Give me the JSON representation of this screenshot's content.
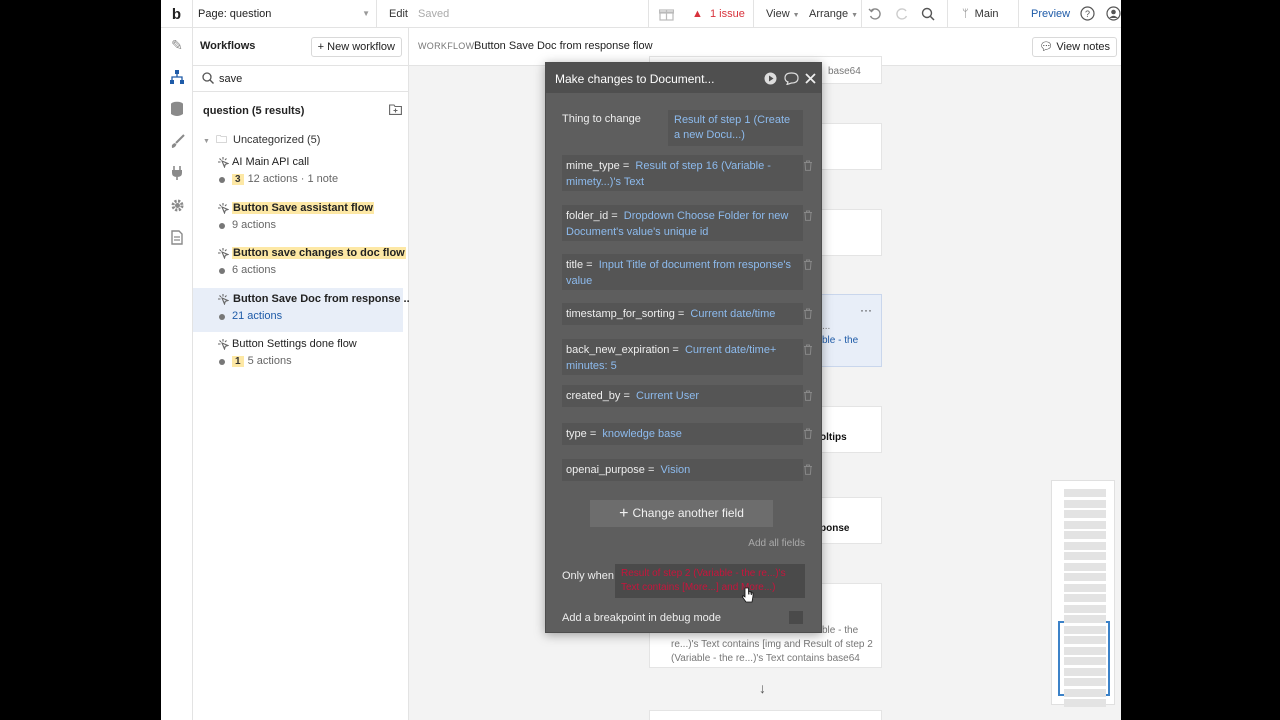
{
  "topbar": {
    "logo": "b",
    "page": "Page: question",
    "edit": "Edit",
    "saved": "Saved",
    "issues": "1 issue",
    "view": "View",
    "arrange": "Arrange",
    "branch": "Main",
    "preview": "Preview"
  },
  "workflows_panel": {
    "title": "Workflows",
    "new_workflow": "New workflow",
    "search_value": "save",
    "results": "question (5 results)",
    "folder": "Uncategorized (5)",
    "items": [
      {
        "name": "AI Main API call",
        "badge": "3",
        "meta": "12 actions · 1 note",
        "highlight": false,
        "selected": false
      },
      {
        "name": "Button Save assistant flow",
        "badge": "",
        "meta": "9 actions",
        "highlight": true,
        "selected": false
      },
      {
        "name": "Button save changes to doc flow",
        "badge": "",
        "meta": "6 actions",
        "highlight": true,
        "selected": false
      },
      {
        "name": "Button Save Doc from response ...",
        "badge": "",
        "meta": "21 actions",
        "highlight": true,
        "selected": true
      },
      {
        "name": "Button Settings done flow",
        "badge": "1",
        "meta": "5 actions",
        "highlight": false,
        "selected": false
      }
    ]
  },
  "canvas": {
    "workflow_label": "WORKFLOW:",
    "workflow_name": "Button Save Doc from response flow",
    "view_notes": "View notes",
    "card_texts": {
      "top": "base64",
      "mid_line1": "...",
      "mid_line2": "ble - the",
      "tooltips": "oltips",
      "response": "ponse",
      "bottom_line1": "ble - the",
      "bottom_line2": "re...)'s Text contains [img and Result of step 2",
      "bottom_line3": "(Variable - the re...)'s Text contains base64",
      "menu": "···"
    }
  },
  "popup": {
    "title": "Make changes to Document...",
    "thing_label": "Thing to change",
    "thing_value": "Result of step 1 (Create a new Docu...)",
    "fields": [
      {
        "key": "mime_type",
        "value": "Result of step 16 (Variable - mimety...)'s Text"
      },
      {
        "key": "folder_id",
        "value": "Dropdown Choose Folder for new Document's value's unique id"
      },
      {
        "key": "title",
        "value": "Input Title of document from response's value"
      },
      {
        "key": "timestamp_for_sorting",
        "value": "Current date/time"
      },
      {
        "key": "back_new_expiration",
        "value": "Current date/time+ minutes: 5"
      },
      {
        "key": "created_by",
        "value": "Current User"
      },
      {
        "key": "type",
        "value": "knowledge base"
      },
      {
        "key": "openai_purpose",
        "value": "Vision"
      }
    ],
    "change_another": "Change another field",
    "add_all": "Add all fields",
    "only_when_label": "Only when",
    "only_when_value": "Result of step 2 (Variable - the re...)'s Text contains [More...] and More...)",
    "breakpoint_label": "Add a breakpoint in debug mode"
  },
  "colors": {
    "accent": "#1e5ba8",
    "highlight": "#fde8a5",
    "popup_bg": "#5e5e5e",
    "link": "#8dbbee",
    "error": "#c8143c"
  }
}
